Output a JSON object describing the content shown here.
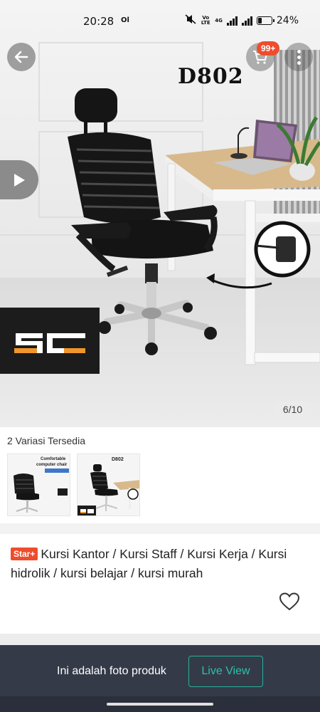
{
  "status_bar": {
    "time": "20:28",
    "extra_indicator": "Ol",
    "network_label": "Vo LTE",
    "network_label_2": "4G",
    "battery_percent": "24%",
    "battery_level": 0.24
  },
  "hero": {
    "model_text": "D802",
    "page_counter": "6/10",
    "cart_badge": "99+",
    "logo_text": "SC"
  },
  "variations": {
    "title": "2 Variasi Tersedia",
    "thumb1": {
      "caption_line1": "Comfortable",
      "caption_line2": "computer chair"
    },
    "thumb2": {
      "model": "D802"
    }
  },
  "product": {
    "badge": "Star+",
    "title": "Kursi Kantor / Kursi Staff / Kursi Kerja / Kursi hidrolik / kursi belajar / kursi murah"
  },
  "bottom_bar": {
    "note": "Ini adalah foto produk",
    "live_button": "Live View"
  },
  "colors": {
    "accent": "#ee4d2d",
    "live_green": "#25b39a",
    "bottom_bar_bg": "#353a49",
    "logo_orange": "#f0962a"
  }
}
